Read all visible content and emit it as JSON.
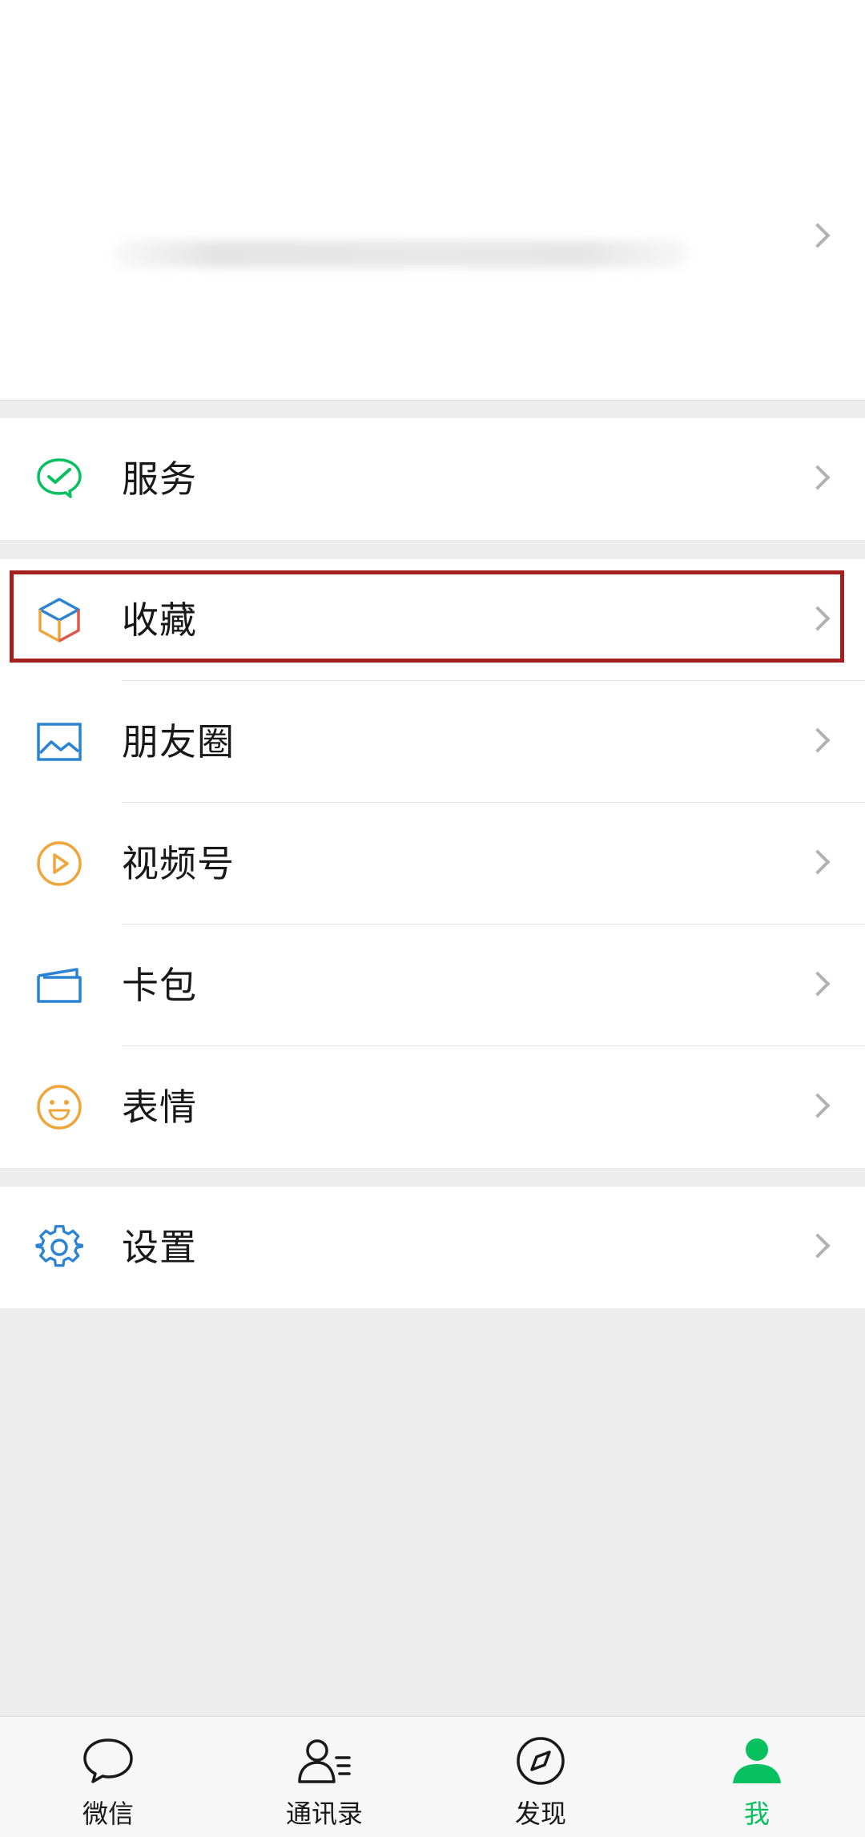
{
  "profile": {
    "chevron_icon": "chevron-right-icon"
  },
  "colors": {
    "accent": "#07c160",
    "highlight": "#a3201e",
    "chevron": "#b2b2b2"
  },
  "groups": {
    "services": [
      {
        "label": "服务",
        "icon": "wechat-pay-icon"
      }
    ],
    "main": [
      {
        "label": "收藏",
        "icon": "favorites-cube-icon"
      },
      {
        "label": "朋友圈",
        "icon": "moments-image-icon"
      },
      {
        "label": "视频号",
        "icon": "channels-play-icon"
      },
      {
        "label": "卡包",
        "icon": "card-wallet-icon"
      },
      {
        "label": "表情",
        "icon": "sticker-smile-icon"
      }
    ],
    "settings": [
      {
        "label": "设置",
        "icon": "settings-gear-icon"
      }
    ]
  },
  "tabbar": [
    {
      "label": "微信",
      "icon": "chat-bubble-icon",
      "active": false
    },
    {
      "label": "通讯录",
      "icon": "contacts-icon",
      "active": false
    },
    {
      "label": "发现",
      "icon": "compass-icon",
      "active": false
    },
    {
      "label": "我",
      "icon": "me-person-icon",
      "active": true
    }
  ]
}
